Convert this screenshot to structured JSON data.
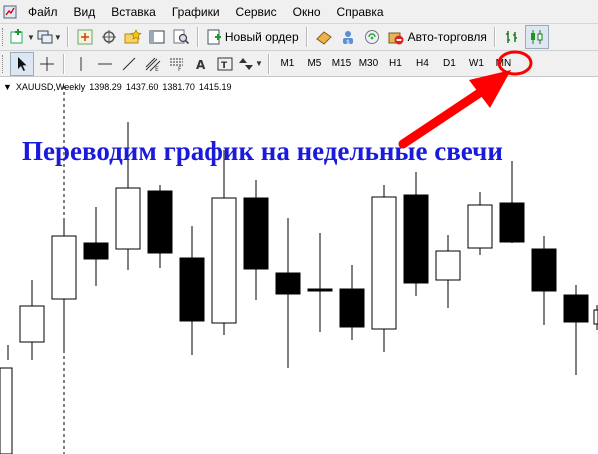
{
  "menubar": {
    "items": [
      {
        "label": "Файл"
      },
      {
        "label": "Вид"
      },
      {
        "label": "Вставка"
      },
      {
        "label": "Графики"
      },
      {
        "label": "Сервис"
      },
      {
        "label": "Окно"
      },
      {
        "label": "Справка"
      }
    ]
  },
  "toolbar": {
    "new_order_label": "Новый ордер",
    "autotrading_label": "Авто-торговля"
  },
  "timeframes": [
    "M1",
    "M5",
    "M15",
    "M30",
    "H1",
    "H4",
    "D1",
    "W1",
    "MN"
  ],
  "selected_timeframe": "W1",
  "chart": {
    "symbol": "XAUUSD,Weekly",
    "open": "1398.29",
    "high": "1437.60",
    "low": "1381.70",
    "close": "1415.19",
    "annotation": "Переводим график на недельные свечи",
    "annotation_color": "#1a1adc",
    "arrow_color": "#ff0000",
    "highlight_color": "#ff0000"
  }
}
